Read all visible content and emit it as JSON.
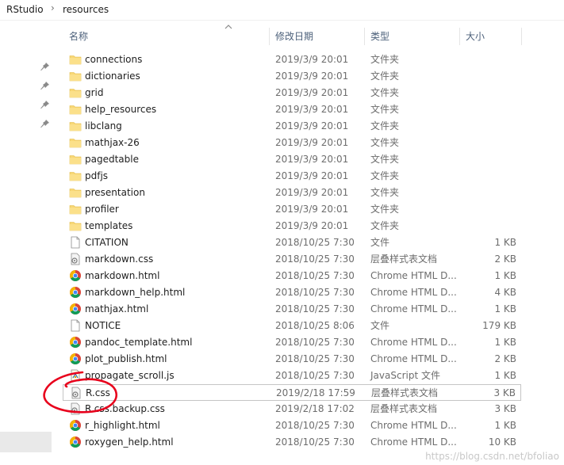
{
  "breadcrumb": {
    "root": "RStudio",
    "current": "resources"
  },
  "columns": {
    "name": "名称",
    "date": "修改日期",
    "type": "类型",
    "size": "大小"
  },
  "files": [
    {
      "name": "connections",
      "date": "2019/3/9 20:01",
      "type": "文件夹",
      "size": "",
      "icon": "folder-icon"
    },
    {
      "name": "dictionaries",
      "date": "2019/3/9 20:01",
      "type": "文件夹",
      "size": "",
      "icon": "folder-icon"
    },
    {
      "name": "grid",
      "date": "2019/3/9 20:01",
      "type": "文件夹",
      "size": "",
      "icon": "folder-icon"
    },
    {
      "name": "help_resources",
      "date": "2019/3/9 20:01",
      "type": "文件夹",
      "size": "",
      "icon": "folder-icon"
    },
    {
      "name": "libclang",
      "date": "2019/3/9 20:01",
      "type": "文件夹",
      "size": "",
      "icon": "folder-icon"
    },
    {
      "name": "mathjax-26",
      "date": "2019/3/9 20:01",
      "type": "文件夹",
      "size": "",
      "icon": "folder-icon"
    },
    {
      "name": "pagedtable",
      "date": "2019/3/9 20:01",
      "type": "文件夹",
      "size": "",
      "icon": "folder-icon"
    },
    {
      "name": "pdfjs",
      "date": "2019/3/9 20:01",
      "type": "文件夹",
      "size": "",
      "icon": "folder-icon"
    },
    {
      "name": "presentation",
      "date": "2019/3/9 20:01",
      "type": "文件夹",
      "size": "",
      "icon": "folder-icon"
    },
    {
      "name": "profiler",
      "date": "2019/3/9 20:01",
      "type": "文件夹",
      "size": "",
      "icon": "folder-icon"
    },
    {
      "name": "templates",
      "date": "2019/3/9 20:01",
      "type": "文件夹",
      "size": "",
      "icon": "folder-icon"
    },
    {
      "name": "CITATION",
      "date": "2018/10/25 7:30",
      "type": "文件",
      "size": "1 KB",
      "icon": "file-icon"
    },
    {
      "name": "markdown.css",
      "date": "2018/10/25 7:30",
      "type": "层叠样式表文档",
      "size": "2 KB",
      "icon": "css-file-icon"
    },
    {
      "name": "markdown.html",
      "date": "2018/10/25 7:30",
      "type": "Chrome HTML D...",
      "size": "1 KB",
      "icon": "chrome-html-icon"
    },
    {
      "name": "markdown_help.html",
      "date": "2018/10/25 7:30",
      "type": "Chrome HTML D...",
      "size": "4 KB",
      "icon": "chrome-html-icon"
    },
    {
      "name": "mathjax.html",
      "date": "2018/10/25 7:30",
      "type": "Chrome HTML D...",
      "size": "1 KB",
      "icon": "chrome-html-icon"
    },
    {
      "name": "NOTICE",
      "date": "2018/10/25 8:06",
      "type": "文件",
      "size": "179 KB",
      "icon": "file-icon"
    },
    {
      "name": "pandoc_template.html",
      "date": "2018/10/25 7:30",
      "type": "Chrome HTML D...",
      "size": "1 KB",
      "icon": "chrome-html-icon"
    },
    {
      "name": "plot_publish.html",
      "date": "2018/10/25 7:30",
      "type": "Chrome HTML D...",
      "size": "2 KB",
      "icon": "chrome-html-icon"
    },
    {
      "name": "propagate_scroll.js",
      "date": "2018/10/25 7:30",
      "type": "JavaScript 文件",
      "size": "1 KB",
      "icon": "js-file-icon"
    },
    {
      "name": "R.css",
      "date": "2019/2/18 17:59",
      "type": "层叠样式表文档",
      "size": "3 KB",
      "icon": "css-file-icon",
      "selected": true
    },
    {
      "name": "R.css.backup.css",
      "date": "2019/2/18 17:02",
      "type": "层叠样式表文档",
      "size": "3 KB",
      "icon": "css-file-icon"
    },
    {
      "name": "r_highlight.html",
      "date": "2018/10/25 7:30",
      "type": "Chrome HTML D...",
      "size": "1 KB",
      "icon": "chrome-html-icon"
    },
    {
      "name": "roxygen_help.html",
      "date": "2018/10/25 7:30",
      "type": "Chrome HTML D...",
      "size": "10 KB",
      "icon": "chrome-html-icon"
    }
  ],
  "watermark": "https://blog.csdn.net/bfoliao",
  "colors": {
    "folder": "#f8d775",
    "annotation": "#e8001c",
    "header_text": "#4c607a"
  }
}
